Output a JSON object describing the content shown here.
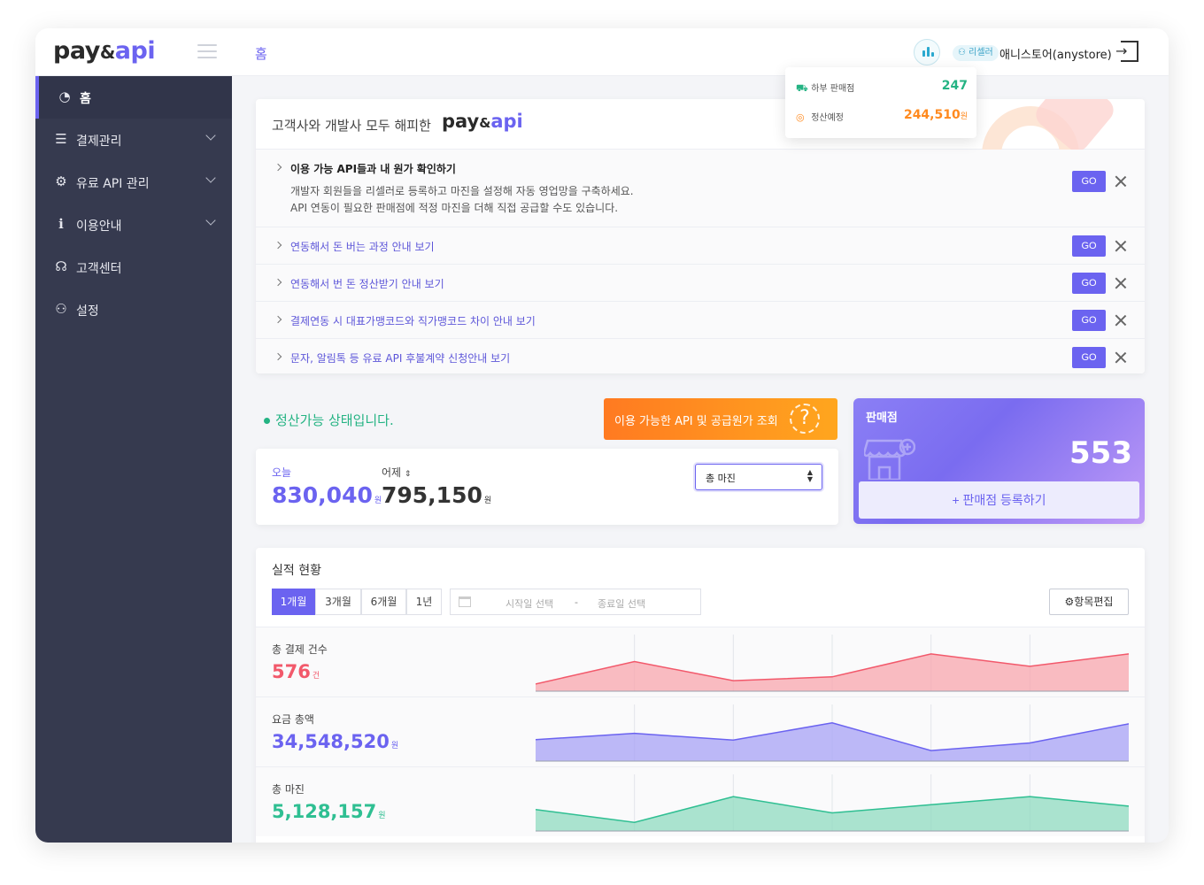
{
  "header": {
    "logo": {
      "main": "pay",
      "amp": "&",
      "accent": "api"
    },
    "breadcrumb": "홈",
    "role_badge": "리셀러",
    "store_name": "애니스토어(anystore)"
  },
  "popover": {
    "rows": [
      {
        "label": "하부 판매점",
        "value": "247",
        "color": "#24b383",
        "icon": "basket-icon"
      },
      {
        "label": "정산예정",
        "value": "244,510",
        "unit": "원",
        "color": "#ff8a1f",
        "icon": "coins-icon"
      }
    ]
  },
  "sidebar": {
    "items": [
      {
        "label": "홈",
        "icon": "dashboard-icon",
        "active": true,
        "expandable": false
      },
      {
        "label": "결제관리",
        "icon": "coins-icon",
        "expandable": true
      },
      {
        "label": "유료 API 관리",
        "icon": "api-gear-icon",
        "expandable": true
      },
      {
        "label": "이용안내",
        "icon": "info-icon",
        "expandable": true
      },
      {
        "label": "고객센터",
        "icon": "headset-icon",
        "expandable": false
      },
      {
        "label": "설정",
        "icon": "user-settings-icon",
        "expandable": false
      }
    ]
  },
  "intro": {
    "title": "고객사와 개발사 모두 해피한",
    "logo": {
      "main": "pay",
      "amp": "&",
      "accent": "api"
    },
    "tips": [
      {
        "title": "이용 가능 API들과 내 원가 확인하기",
        "desc1": "개발자 회원들을 리셀러로 등록하고 마진을 설정해 자동 영업망을 구축하세요.",
        "desc2": "API 연동이 필요한 판매점에 적정 마진을 더해 직접 공급할 수도 있습니다."
      },
      {
        "title": "연동해서 돈 버는 과정 안내 보기"
      },
      {
        "title": "연동해서 번 돈 정산받기 안내 보기"
      },
      {
        "title": "결제연동 시 대표가맹코드와 직가맹코드 차이 안내 보기"
      },
      {
        "title": "문자, 알림톡 등 유료 API 후불계약 신청안내 보기"
      }
    ],
    "go_label": "GO"
  },
  "status_text": "정산가능 상태입니다.",
  "api_button_label": "이용 가능한 API 및 공급원가 조회",
  "today": {
    "today_label": "오늘",
    "today_value": "830,040",
    "yesterday_label": "어제",
    "yesterday_value": "795,150",
    "unit": "원",
    "select_value": "총 마진"
  },
  "store_card": {
    "title": "판매점",
    "count": "553",
    "register_label": "+ 판매점 등록하기"
  },
  "performance": {
    "title": "실적 현황",
    "periods": [
      "1개월",
      "3개월",
      "6개월",
      "1년"
    ],
    "active_period": "1개월",
    "start_placeholder": "시작일 선택",
    "separator": "-",
    "end_placeholder": "종료일 선택",
    "edit_label": "항목편집",
    "metrics": [
      {
        "label": "총 결제 건수",
        "value": "576",
        "unit": "건",
        "color": "#f2596b",
        "fill": "#f8a6ae",
        "trend": [
          0.15,
          0.62,
          0.22,
          0.3,
          0.78,
          0.52,
          0.78
        ]
      },
      {
        "label": "요금 총액",
        "value": "34,548,520",
        "unit": "원",
        "color": "#6b63f0",
        "fill": "#a7a2f5",
        "trend": [
          0.45,
          0.58,
          0.44,
          0.8,
          0.22,
          0.38,
          0.78
        ]
      },
      {
        "label": "총 마진",
        "value": "5,128,157",
        "unit": "원",
        "color": "#2fbf92",
        "fill": "#8fdbc0",
        "trend": [
          0.45,
          0.18,
          0.72,
          0.38,
          0.55,
          0.72,
          0.52
        ]
      }
    ]
  }
}
